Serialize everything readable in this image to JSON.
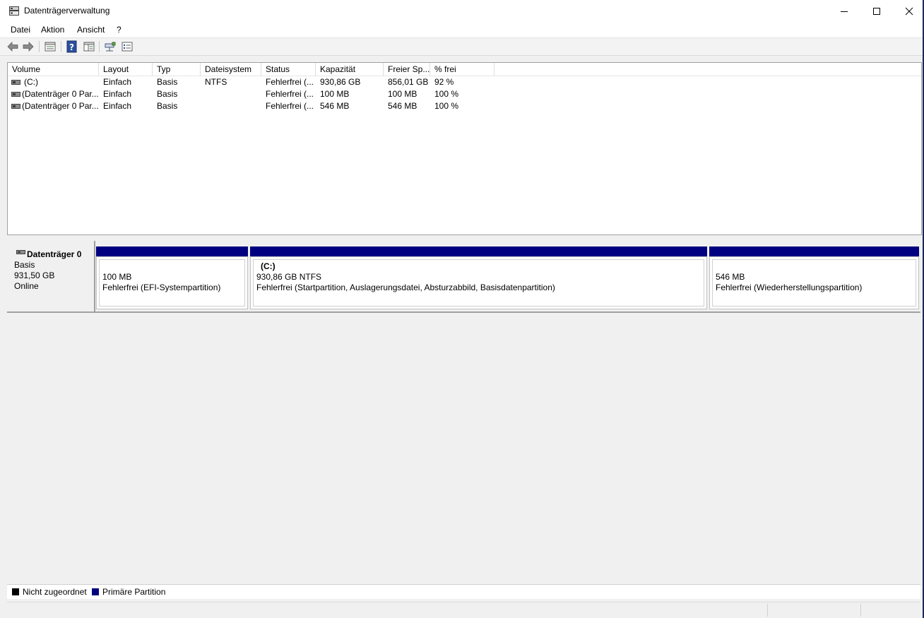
{
  "window": {
    "title": "Datenträgerverwaltung"
  },
  "menu": [
    "Datei",
    "Aktion",
    "Ansicht",
    "?"
  ],
  "toolbar": [
    "back-arrow-icon",
    "forward-arrow-icon",
    "properties-icon",
    "help-icon",
    "console-tree-icon",
    "connect-icon",
    "list-view-icon"
  ],
  "volumes": {
    "headers": [
      "Volume",
      "Layout",
      "Typ",
      "Dateisystem",
      "Status",
      "Kapazität",
      "Freier Sp...",
      "% frei"
    ],
    "rows": [
      [
        "(C:)",
        "Einfach",
        "Basis",
        "NTFS",
        "Fehlerfrei (...",
        "930,86 GB",
        "856,01 GB",
        "92 %"
      ],
      [
        "(Datenträger 0 Par...",
        "Einfach",
        "Basis",
        "",
        "Fehlerfrei (...",
        "100 MB",
        "100 MB",
        "100 %"
      ],
      [
        "(Datenträger 0 Par...",
        "Einfach",
        "Basis",
        "",
        "Fehlerfrei (...",
        "546 MB",
        "546 MB",
        "100 %"
      ]
    ]
  },
  "disk": {
    "name": "Datenträger 0",
    "type": "Basis",
    "size": "931,50 GB",
    "state": "Online",
    "partitions": [
      {
        "label": "",
        "size": "100 MB",
        "status": "Fehlerfrei (EFI-Systempartition)"
      },
      {
        "label": "(C:)",
        "size": "930,86 GB NTFS",
        "status": "Fehlerfrei (Startpartition, Auslagerungsdatei, Absturzabbild, Basisdatenpartition)"
      },
      {
        "label": "",
        "size": "546 MB",
        "status": "Fehlerfrei (Wiederherstellungspartition)"
      }
    ]
  },
  "legend": [
    {
      "label": "Nicht zugeordnet",
      "color": "#000000"
    },
    {
      "label": "Primäre Partition",
      "color": "#000080"
    }
  ],
  "colors": {
    "partition_bar": "#000080",
    "accent": "#0063b1"
  }
}
